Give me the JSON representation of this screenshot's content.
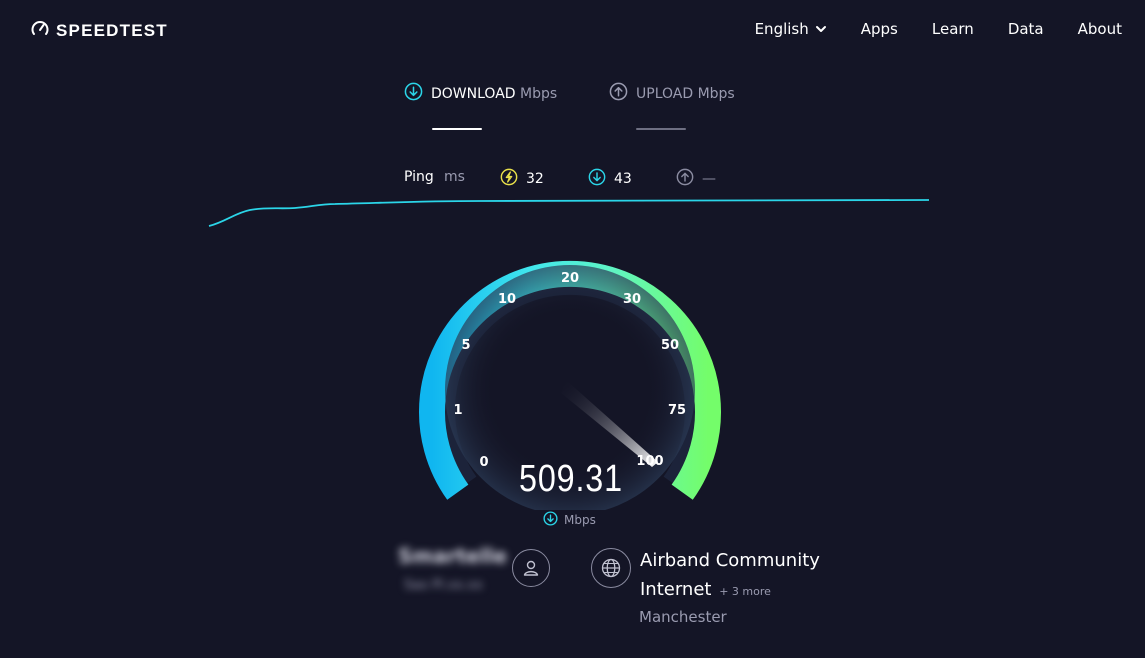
{
  "app": {
    "name": "SPEEDTEST"
  },
  "nav": {
    "language": "English",
    "apps": "Apps",
    "learn": "Learn",
    "data": "Data",
    "about": "About"
  },
  "tabs": {
    "download": {
      "label": "DOWNLOAD",
      "unit": "Mbps"
    },
    "upload": {
      "label": "UPLOAD",
      "unit": "Mbps"
    }
  },
  "ping": {
    "label": "Ping",
    "unit": "ms",
    "idle": "32",
    "download": "43",
    "upload": "—"
  },
  "gauge": {
    "ticks": [
      "0",
      "1",
      "5",
      "10",
      "20",
      "30",
      "50",
      "75",
      "100"
    ],
    "value": "509.31",
    "unit": "Mbps"
  },
  "connection": {
    "isp_line1": "Airband Community",
    "isp_line2": "Internet",
    "isp_more": "+ 3 more",
    "location": "Manchester",
    "user_blurred_name": "Smartelle",
    "user_blurred_sub": "Sao Pl.xx.xx"
  },
  "colors": {
    "background": "#141526",
    "accent_cyan": "#2bd5e8",
    "accent_green": "#6cfd7a",
    "ping_yellow": "#e8e04a",
    "muted_text": "#9a9bb0"
  }
}
